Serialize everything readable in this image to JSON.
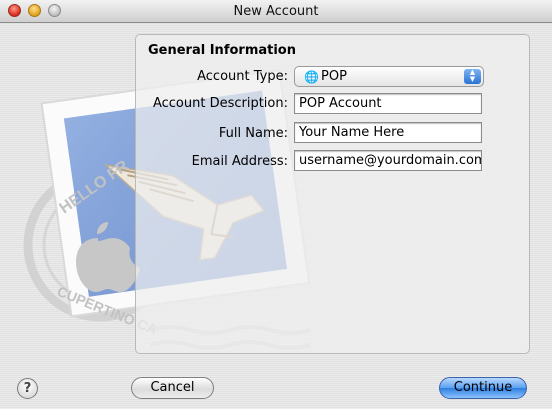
{
  "window": {
    "title": "New Account"
  },
  "section": {
    "title": "General Information"
  },
  "form": {
    "account_type": {
      "label": "Account Type:",
      "value": "POP",
      "icon": "globe-icon"
    },
    "account_description": {
      "label": "Account Description:",
      "value": "POP Account"
    },
    "full_name": {
      "label": "Full Name:",
      "value": "Your Name Here"
    },
    "email_address": {
      "label": "Email Address:",
      "value": "username@yourdomain.com"
    }
  },
  "stamp": {
    "text_top": "HELLO FR",
    "text_bottom": "CUPERTINO CA"
  },
  "buttons": {
    "help": "?",
    "cancel": "Cancel",
    "continue": "Continue"
  },
  "colors": {
    "accent": "#2e7fe0",
    "stamp_blue": "#7f9fd6"
  }
}
